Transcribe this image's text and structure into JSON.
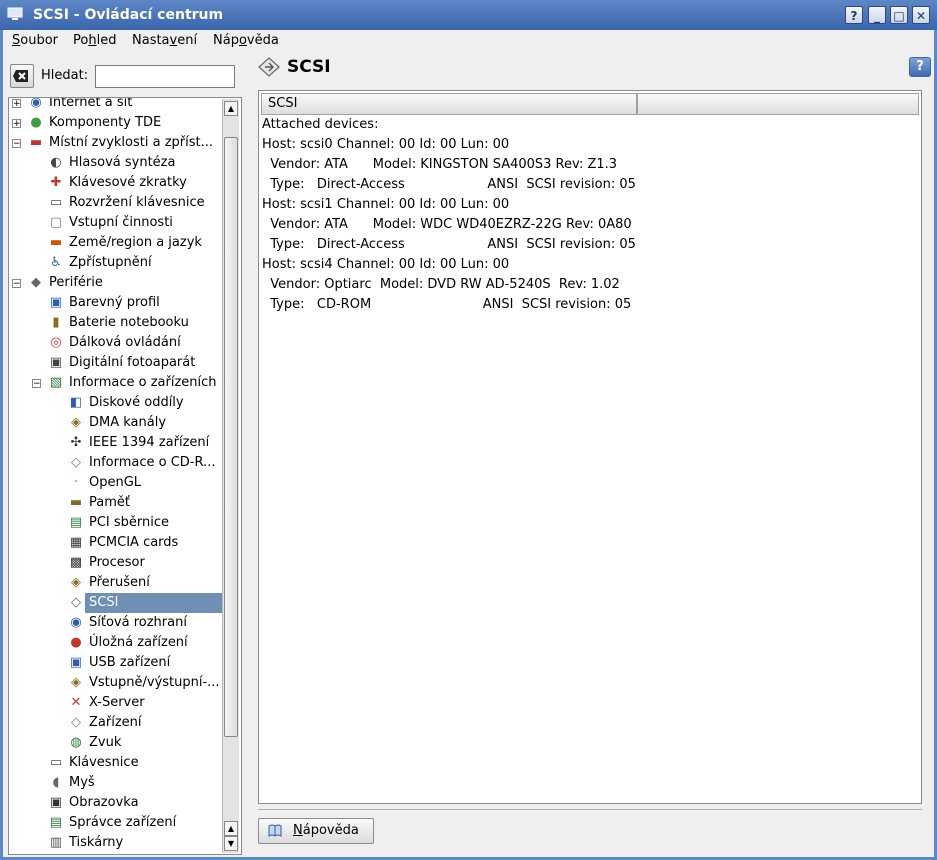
{
  "window": {
    "title": "SCSI - Ovládací centrum",
    "buttons": [
      "?",
      "_",
      "□",
      "✕"
    ]
  },
  "menu": [
    {
      "label": "Soubor",
      "accel": "S"
    },
    {
      "label": "Pohled",
      "accel": "h"
    },
    {
      "label": "Nastavení",
      "accel": "v"
    },
    {
      "label": "Nápověda",
      "accel": "o"
    }
  ],
  "search": {
    "label": "Hledat:",
    "value": "",
    "placeholder": ""
  },
  "tree": [
    {
      "label": "Internet a síť",
      "level": 0,
      "expander": "+",
      "icon": "globe-icon"
    },
    {
      "label": "Komponenty TDE",
      "level": 0,
      "expander": "+",
      "icon": "components-icon"
    },
    {
      "label": "Místní zvyklosti a zpříst...",
      "level": 0,
      "expander": "−",
      "icon": "locale-icon"
    },
    {
      "label": "Hlasová syntéza",
      "level": 1,
      "icon": "speech-icon"
    },
    {
      "label": "Klávesové zkratky",
      "level": 1,
      "icon": "shortcut-icon"
    },
    {
      "label": "Rozvržení klávesnice",
      "level": 1,
      "icon": "keyboard-icon"
    },
    {
      "label": "Vstupní činnosti",
      "level": 1,
      "icon": "input-actions-icon"
    },
    {
      "label": "Země/region a jazyk",
      "level": 1,
      "icon": "flag-icon"
    },
    {
      "label": "Zpřístupnění",
      "level": 1,
      "icon": "accessibility-icon"
    },
    {
      "label": "Periférie",
      "level": 0,
      "expander": "−",
      "icon": "peripherals-icon"
    },
    {
      "label": "Barevný profil",
      "level": 1,
      "icon": "color-profile-icon"
    },
    {
      "label": "Baterie notebooku",
      "level": 1,
      "icon": "battery-icon"
    },
    {
      "label": "Dálková ovládání",
      "level": 1,
      "icon": "remote-icon"
    },
    {
      "label": "Digitální fotoaparát",
      "level": 1,
      "icon": "camera-icon"
    },
    {
      "label": "Informace o zařízeních",
      "level": 1,
      "expander": "−",
      "icon": "device-info-icon"
    },
    {
      "label": "Diskové oddíly",
      "level": 2,
      "icon": "partition-icon"
    },
    {
      "label": "DMA kanály",
      "level": 2,
      "icon": "dma-icon"
    },
    {
      "label": "IEEE 1394 zařízení",
      "level": 2,
      "icon": "ieee1394-icon"
    },
    {
      "label": "Informace o CD-R...",
      "level": 2,
      "icon": "cd-icon"
    },
    {
      "label": "OpenGL",
      "level": 2,
      "icon": "opengl-icon"
    },
    {
      "label": "Paměť",
      "level": 2,
      "icon": "memory-icon"
    },
    {
      "label": "PCI sběrnice",
      "level": 2,
      "icon": "pci-icon"
    },
    {
      "label": "PCMCIA cards",
      "level": 2,
      "icon": "pcmcia-icon"
    },
    {
      "label": "Procesor",
      "level": 2,
      "icon": "cpu-icon"
    },
    {
      "label": "Přerušení",
      "level": 2,
      "icon": "interrupt-icon"
    },
    {
      "label": "SCSI",
      "level": 2,
      "icon": "scsi-icon",
      "selected": true
    },
    {
      "label": "Síťová rozhraní",
      "level": 2,
      "icon": "network-icon"
    },
    {
      "label": "Úložná zařízení",
      "level": 2,
      "icon": "storage-icon"
    },
    {
      "label": "USB zařízení",
      "level": 2,
      "icon": "usb-icon"
    },
    {
      "label": "Vstupně/výstupní-...",
      "level": 2,
      "icon": "io-icon"
    },
    {
      "label": "X-Server",
      "level": 2,
      "icon": "x-server-icon"
    },
    {
      "label": "Zařízení",
      "level": 2,
      "icon": "devices-icon"
    },
    {
      "label": "Zvuk",
      "level": 2,
      "icon": "sound-icon"
    },
    {
      "label": "Klávesnice",
      "level": 1,
      "icon": "keyboard-icon"
    },
    {
      "label": "Myš",
      "level": 1,
      "icon": "mouse-icon"
    },
    {
      "label": "Obrazovka",
      "level": 1,
      "icon": "display-icon"
    },
    {
      "label": "Správce zařízení",
      "level": 1,
      "icon": "device-manager-icon"
    },
    {
      "label": "Tiskárny",
      "level": 1,
      "icon": "printer-icon"
    }
  ],
  "page": {
    "title": "SCSI",
    "help_label": "?"
  },
  "table": {
    "columns": [
      "SCSI",
      ""
    ],
    "lines": [
      "Attached devices:",
      "Host: scsi0 Channel: 00 Id: 00 Lun: 00",
      "  Vendor: ATA      Model: KINGSTON SA400S3 Rev: Z1.3",
      "  Type:   Direct-Access                    ANSI  SCSI revision: 05",
      "Host: scsi1 Channel: 00 Id: 00 Lun: 00",
      "  Vendor: ATA      Model: WDC WD40EZRZ-22G Rev: 0A80",
      "  Type:   Direct-Access                    ANSI  SCSI revision: 05",
      "Host: scsi4 Channel: 00 Id: 00 Lun: 00",
      "  Vendor: Optiarc  Model: DVD RW AD-5240S  Rev: 1.02",
      "  Type:   CD-ROM                           ANSI  SCSI revision: 05"
    ]
  },
  "footer": {
    "help_button": "Nápověda"
  }
}
